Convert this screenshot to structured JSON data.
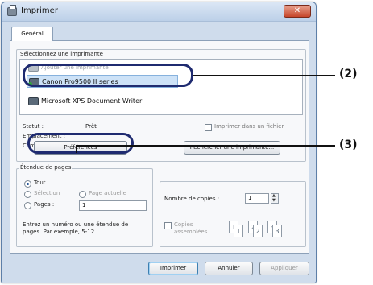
{
  "window": {
    "title": "Imprimer",
    "close_glyph": "✕"
  },
  "tabs": [
    {
      "label": "Général"
    }
  ],
  "printer_select": {
    "group_label": "Sélectionnez une imprimante",
    "items": [
      {
        "label": "Ajouter une imprimante",
        "icon": "add-printer-icon",
        "state": "faded"
      },
      {
        "label": "Canon Pro9500 II series",
        "icon": "printer-icon",
        "state": "selected"
      },
      {
        "label": "Microsoft XPS Document Writer",
        "icon": "printer-icon",
        "state": "normal"
      }
    ],
    "status_label": "Statut :",
    "status_value": "Prêt",
    "location_label": "Emplacement :",
    "location_value": "",
    "comment_label": "Commentaire :",
    "comment_value": "",
    "print_to_file_label": "Imprimer dans un fichier",
    "preferences_button": "Préférences",
    "find_printer_button": "Rechercher une imprimante..."
  },
  "page_range": {
    "group_label": "Étendue de pages",
    "all_label": "Tout",
    "selection_label": "Sélection",
    "current_page_label": "Page actuelle",
    "pages_label": "Pages :",
    "pages_value": "1",
    "hint": "Entrez un numéro ou une étendue de pages. Par exemple, 5-12"
  },
  "copies": {
    "count_label": "Nombre de copies :",
    "count_value": "1",
    "collate_label": "Copies assemblées",
    "collate_pages": [
      "1",
      "1",
      "2",
      "2",
      "3",
      "3"
    ]
  },
  "footer": {
    "print_button": "Imprimer",
    "cancel_button": "Annuler",
    "apply_button": "Appliquer"
  },
  "callouts": {
    "printer": "(2)",
    "preferences": "(3)"
  },
  "colors": {
    "highlight": "#1f2b70",
    "close": "#c6452a",
    "selection": "#cde2f7"
  }
}
